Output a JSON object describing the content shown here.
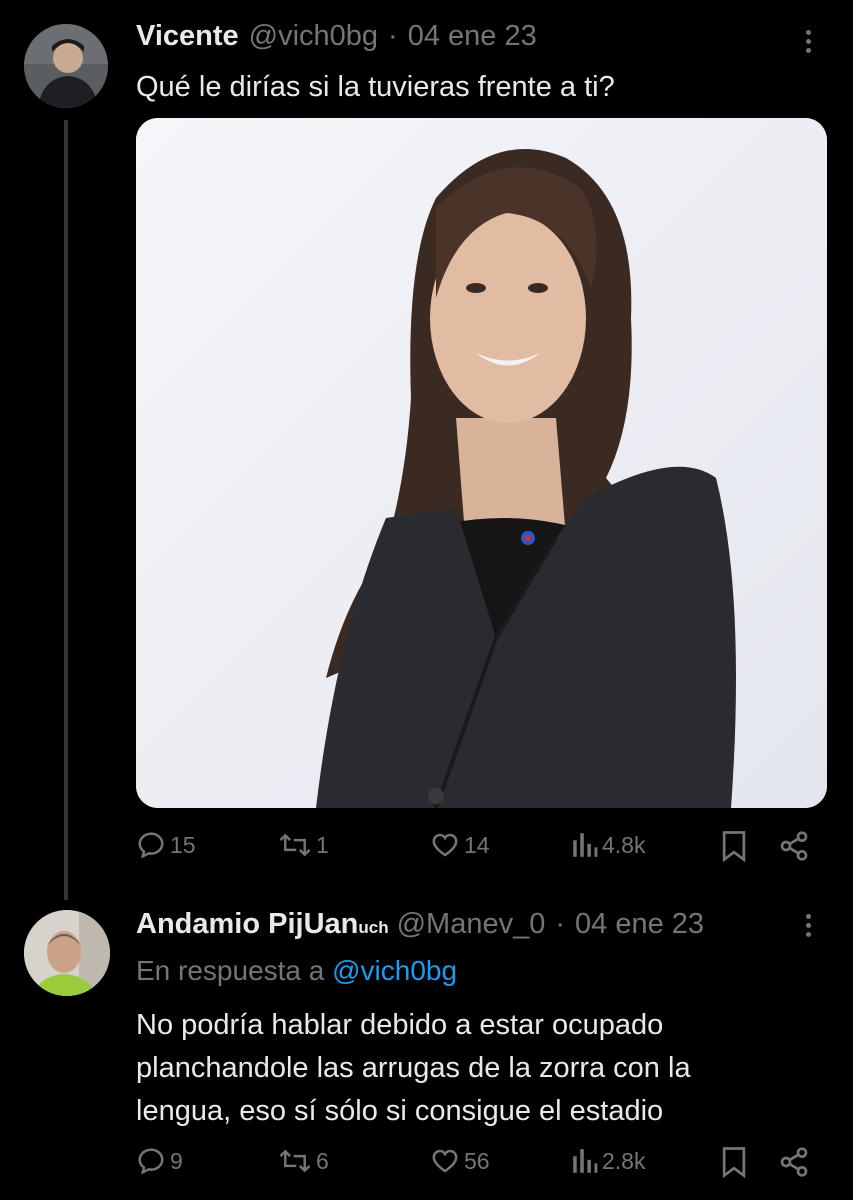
{
  "tweets": [
    {
      "author_name": "Vicente",
      "handle": "@vich0bg",
      "date": "04 ene 23",
      "text": "Qué le dirías si la tuvieras frente a ti?",
      "actions": {
        "replies": "15",
        "retweets": "1",
        "likes": "14",
        "views": "4.8k"
      }
    },
    {
      "author_name": "Andamio PijUan",
      "author_suffix": "uch",
      "handle": "@Manev_0",
      "date": "04 ene 23",
      "reply_prefix": "En respuesta a",
      "reply_handle": "@vich0bg",
      "text_lines": [
        "No podría hablar debido a estar ocupado",
        "planchandole las arrugas de la zorra con la",
        "lengua, eso sí sólo si consigue el estadio"
      ],
      "actions": {
        "replies": "9",
        "retweets": "6",
        "likes": "56",
        "views": "2.8k"
      }
    }
  ],
  "separator": "·",
  "icons": [
    "reply-icon",
    "retweet-icon",
    "like-icon",
    "views-icon",
    "bookmark-icon",
    "share-icon",
    "more-icon"
  ],
  "colors": {
    "background": "#000000",
    "text": "#e7e9ea",
    "muted": "#71767b",
    "link": "#1d9bf0",
    "thread_line": "#333639"
  }
}
